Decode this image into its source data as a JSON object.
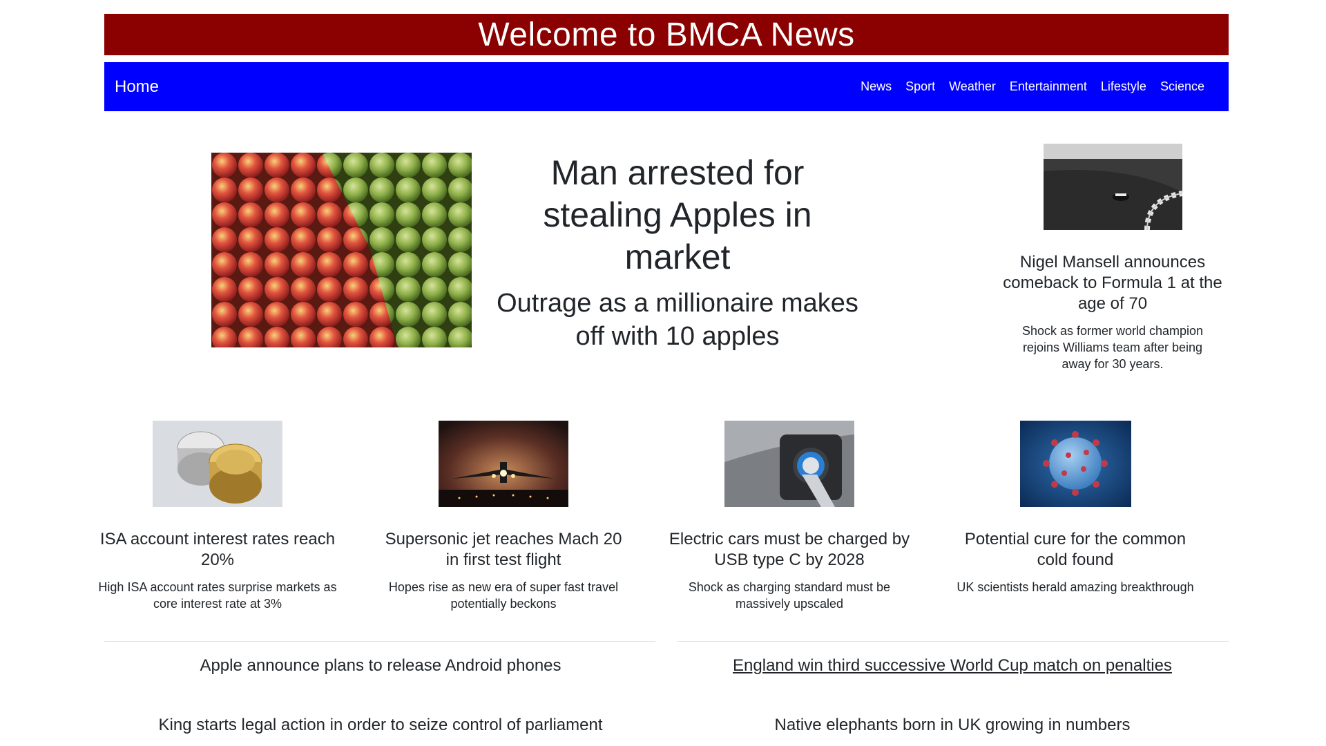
{
  "banner": {
    "title": "Welcome to BMCA News"
  },
  "nav": {
    "home": "Home",
    "links": [
      "News",
      "Sport",
      "Weather",
      "Entertainment",
      "Lifestyle",
      "Science"
    ]
  },
  "hero": {
    "title": "Man arrested for stealing Apples in market",
    "subtitle": "Outrage as a millionaire makes off with 10 apples"
  },
  "side_story": {
    "title": "Nigel Mansell announces comeback to Formula 1 at the age of 70",
    "description": "Shock as former world champion rejoins Williams team after being away for 30 years."
  },
  "cards": [
    {
      "title": "ISA account interest rates reach 20%",
      "description": "High ISA account rates surprise markets as core interest rate at 3%"
    },
    {
      "title": "Supersonic jet reaches Mach 20 in first test flight",
      "description": "Hopes rise as new era of super fast travel potentially beckons"
    },
    {
      "title": "Electric cars must be charged by USB type C by 2028",
      "description": "Shock as charging standard must be massively upscaled"
    },
    {
      "title": "Potential cure for the common cold found",
      "description": "UK scientists herald amazing breakthrough"
    }
  ],
  "headlines": [
    "Apple announce plans to release Android phones",
    "England win third successive World Cup match on penalties",
    "King starts legal action in order to seize control of parliament",
    "Native elephants born in UK growing in numbers"
  ],
  "colors": {
    "banner": "#8b0000",
    "navbar": "#0000ff"
  }
}
